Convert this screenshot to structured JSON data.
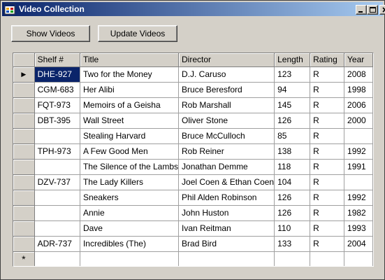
{
  "window": {
    "title": "Video Collection",
    "title_bar_color": "#0a246a",
    "app_icon": "app-form-icon",
    "controls": [
      "minimize-icon",
      "maximize-icon",
      "close-icon"
    ]
  },
  "toolbar": {
    "show_videos_label": "Show Videos",
    "update_videos_label": "Update Videos"
  },
  "grid": {
    "selection_color": "#0a246a",
    "current_row_marker": "▶",
    "new_row_marker": "*",
    "columns": [
      "Shelf #",
      "Title",
      "Director",
      "Length",
      "Rating",
      "Year"
    ],
    "rows": [
      [
        "DHE-927",
        "Two for the Money",
        "D.J. Caruso",
        "123",
        "R",
        "2008"
      ],
      [
        "CGM-683",
        "Her Alibi",
        "Bruce Beresford",
        "94",
        "R",
        "1998"
      ],
      [
        "FQT-973",
        "Memoirs of a Geisha",
        "Rob Marshall",
        "145",
        "R",
        "2006"
      ],
      [
        "DBT-395",
        "Wall Street",
        "Oliver Stone",
        "126",
        "R",
        "2000"
      ],
      [
        "",
        "Stealing Harvard",
        "Bruce McCulloch",
        "85",
        "R",
        ""
      ],
      [
        "TPH-973",
        "A Few Good Men",
        "Rob Reiner",
        "138",
        "R",
        "1992"
      ],
      [
        "",
        "The Silence of the Lambs",
        "Jonathan Demme",
        "118",
        "R",
        "1991"
      ],
      [
        "DZV-737",
        "The Lady Killers",
        "Joel Coen & Ethan Coen",
        "104",
        "R",
        ""
      ],
      [
        "",
        "Sneakers",
        "Phil Alden Robinson",
        "126",
        "R",
        "1992"
      ],
      [
        "",
        "Annie",
        "John Huston",
        "126",
        "R",
        "1982"
      ],
      [
        "",
        "Dave",
        "Ivan Reitman",
        "110",
        "R",
        "1993"
      ],
      [
        "ADR-737",
        "Incredibles (The)",
        "Brad Bird",
        "133",
        "R",
        "2004"
      ]
    ]
  }
}
